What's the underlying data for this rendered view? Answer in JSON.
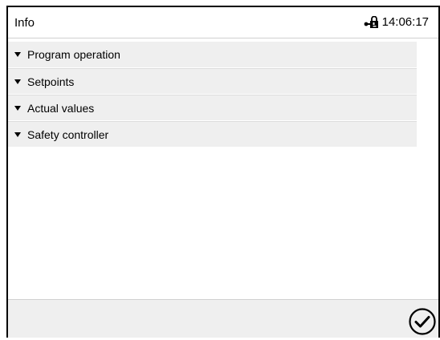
{
  "header": {
    "title": "Info",
    "time": "14:06:17",
    "lock_icon": "lock-icon"
  },
  "list": {
    "items": [
      {
        "label": "Program operation",
        "icon": "triangle-down-icon"
      },
      {
        "label": "Setpoints",
        "icon": "triangle-down-icon"
      },
      {
        "label": "Actual values",
        "icon": "triangle-down-icon"
      },
      {
        "label": "Safety controller",
        "icon": "triangle-down-icon"
      }
    ]
  },
  "footer": {
    "confirm_icon": "checkmark-circle-icon"
  }
}
